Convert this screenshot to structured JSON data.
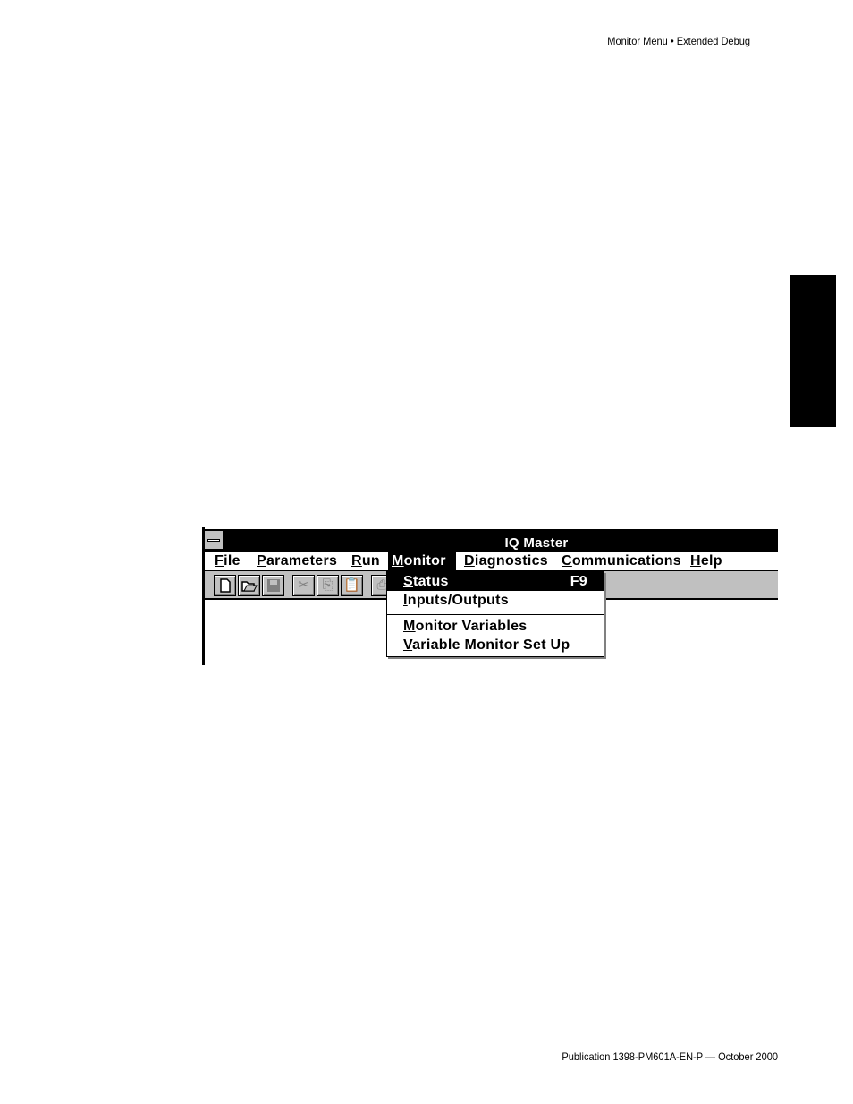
{
  "page": {
    "header": "Monitor Menu • Extended Debug",
    "footer": "Publication 1398-PM601A-EN-P — October 2000"
  },
  "window": {
    "title": "IQ Master",
    "menu": [
      {
        "pre": "",
        "key": "F",
        "post": "ile"
      },
      {
        "pre": "",
        "key": "P",
        "post": "arameters"
      },
      {
        "pre": "",
        "key": "R",
        "post": "un"
      },
      {
        "pre": "",
        "key": "M",
        "post": "onitor"
      },
      {
        "pre": "",
        "key": "D",
        "post": "iagnostics"
      },
      {
        "pre": "",
        "key": "C",
        "post": "ommunications"
      },
      {
        "pre": "",
        "key": "H",
        "post": "elp"
      }
    ],
    "toolbar": [
      "new-file",
      "open-folder",
      "save",
      "cut",
      "copy",
      "paste",
      "print"
    ],
    "dropdown": {
      "items": [
        {
          "pre": "",
          "key": "S",
          "post": "tatus",
          "accel": "F9"
        },
        {
          "pre": "",
          "key": "I",
          "post": "nputs/Outputs",
          "accel": ""
        },
        {
          "pre": "",
          "key": "M",
          "post": "onitor Variables",
          "accel": ""
        },
        {
          "pre": "",
          "key": "V",
          "post": "ariable Monitor Set Up",
          "accel": ""
        }
      ]
    }
  },
  "icons": {
    "new": "📄",
    "open": "📂",
    "save": "💾",
    "cut": "✂",
    "copy": "⎘",
    "paste": "📋",
    "print": "⎙"
  }
}
